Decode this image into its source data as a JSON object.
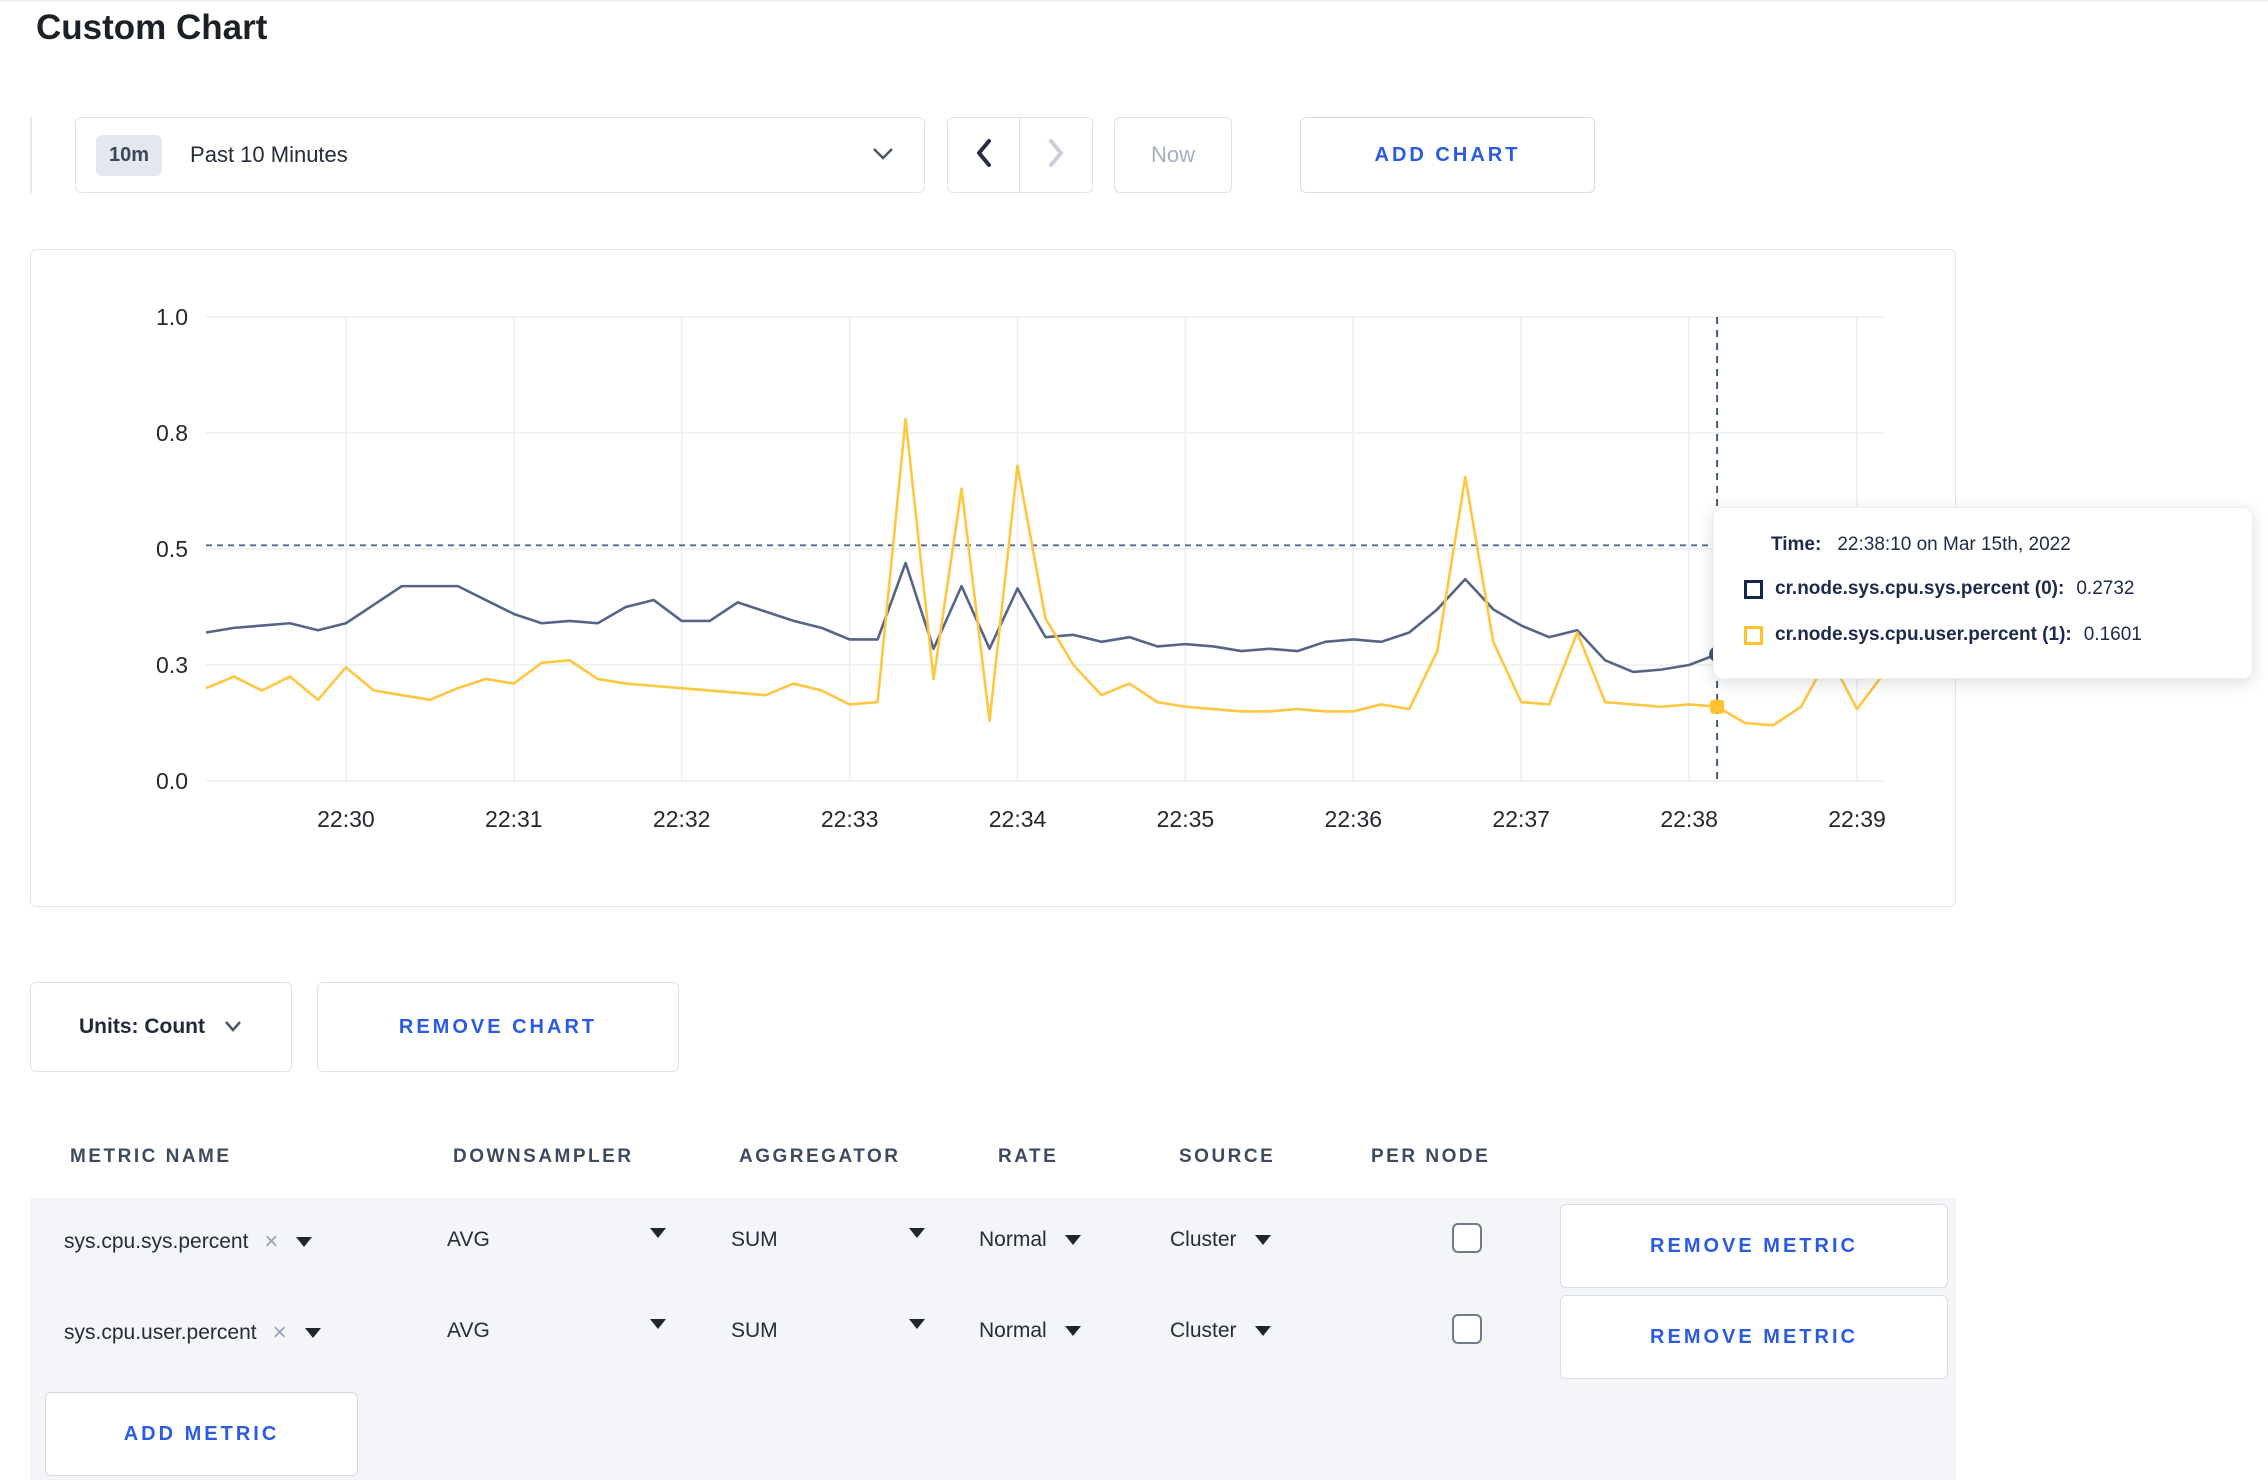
{
  "page": {
    "title": "Custom Chart"
  },
  "toolbar": {
    "time_range": {
      "badge": "10m",
      "label": "Past 10 Minutes"
    },
    "now_label": "Now",
    "add_chart_label": "ADD CHART"
  },
  "chart": {
    "tooltip": {
      "time_label": "Time:",
      "time_value": "22:38:10 on Mar 15th, 2022",
      "series": [
        {
          "label": "cr.node.sys.cpu.sys.percent (0):",
          "value": "0.2732",
          "swatch_color": "#16264d"
        },
        {
          "label": "cr.node.sys.cpu.user.percent (1):",
          "value": "0.1601",
          "swatch_color": "#ffc12e"
        }
      ]
    },
    "units_label": "Units: Count",
    "remove_chart_label": "REMOVE CHART"
  },
  "chart_data": {
    "type": "line",
    "title": "",
    "xlabel": "",
    "ylabel": "",
    "ylim": [
      0,
      1
    ],
    "grid": true,
    "x_start": "22:29:10",
    "x_interval_seconds": 10,
    "x_first_tick_offset_seconds": 50,
    "x_tick_step_seconds": 60,
    "x_ticks": [
      "22:30",
      "22:31",
      "22:32",
      "22:33",
      "22:34",
      "22:35",
      "22:36",
      "22:37",
      "22:38",
      "22:39"
    ],
    "y_ticks": [
      "0.0",
      "0.3",
      "0.5",
      "0.8",
      "1.0"
    ],
    "y_tick_values": [
      0,
      0.25,
      0.5,
      0.75,
      1.0
    ],
    "guide_value": 0.508,
    "crosshair_index": 54,
    "crosshair_time": "22:38:10",
    "series": [
      {
        "name": "cr.node.sys.cpu.sys.percent",
        "color": "#566486",
        "marker": "circle",
        "values": [
          0.32,
          0.33,
          0.335,
          0.34,
          0.325,
          0.34,
          0.38,
          0.42,
          0.42,
          0.42,
          0.39,
          0.36,
          0.34,
          0.345,
          0.34,
          0.375,
          0.39,
          0.345,
          0.345,
          0.385,
          0.365,
          0.345,
          0.33,
          0.305,
          0.305,
          0.47,
          0.285,
          0.42,
          0.285,
          0.415,
          0.31,
          0.315,
          0.3,
          0.31,
          0.29,
          0.295,
          0.29,
          0.28,
          0.285,
          0.28,
          0.3,
          0.305,
          0.3,
          0.32,
          0.37,
          0.435,
          0.37,
          0.335,
          0.31,
          0.325,
          0.26,
          0.235,
          0.24,
          0.25,
          0.2732,
          0.25,
          0.26,
          0.275,
          0.29,
          0.295,
          0.3
        ]
      },
      {
        "name": "cr.node.sys.cpu.user.percent",
        "color": "#ffc640",
        "marker": "square",
        "values": [
          0.2,
          0.225,
          0.195,
          0.225,
          0.175,
          0.245,
          0.195,
          0.185,
          0.175,
          0.2,
          0.22,
          0.21,
          0.255,
          0.26,
          0.22,
          0.21,
          0.205,
          0.2,
          0.195,
          0.19,
          0.185,
          0.21,
          0.195,
          0.165,
          0.17,
          0.78,
          0.22,
          0.63,
          0.13,
          0.68,
          0.35,
          0.25,
          0.185,
          0.21,
          0.17,
          0.16,
          0.155,
          0.15,
          0.15,
          0.155,
          0.15,
          0.15,
          0.165,
          0.155,
          0.28,
          0.655,
          0.3,
          0.17,
          0.165,
          0.32,
          0.17,
          0.165,
          0.16,
          0.165,
          0.1601,
          0.125,
          0.12,
          0.16,
          0.27,
          0.155,
          0.235
        ]
      }
    ]
  },
  "metrics_table": {
    "headers": [
      "METRIC NAME",
      "DOWNSAMPLER",
      "AGGREGATOR",
      "RATE",
      "SOURCE",
      "PER NODE"
    ],
    "rows": [
      {
        "metric": "sys.cpu.sys.percent",
        "downsampler": "AVG",
        "aggregator": "SUM",
        "rate": "Normal",
        "source": "Cluster",
        "per_node_checked": false,
        "remove_label": "REMOVE METRIC"
      },
      {
        "metric": "sys.cpu.user.percent",
        "downsampler": "AVG",
        "aggregator": "SUM",
        "rate": "Normal",
        "source": "Cluster",
        "per_node_checked": false,
        "remove_label": "REMOVE METRIC"
      }
    ],
    "add_metric_label": "ADD METRIC"
  }
}
